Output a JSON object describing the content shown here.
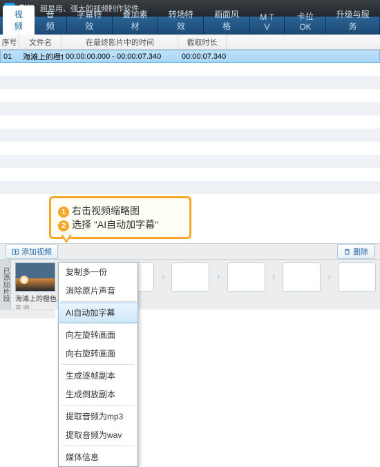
{
  "titlebar": {
    "app_name": "影忆",
    "tagline": "超易用、强大的视频制作软件"
  },
  "tabs": [
    "视 频",
    "音 频",
    "字幕特效",
    "叠加素材",
    "转场特效",
    "画面风格",
    "M T V",
    "卡拉OK",
    "升级与服务"
  ],
  "active_tab": 0,
  "columns": {
    "c1": "序号",
    "c2": "文件名",
    "c3": "在最终影片中的时间",
    "c4": "截取时长"
  },
  "row": {
    "idx": "01",
    "name": "海滩上的橙色..",
    "time": "00:00:00.000 - 00:00:07.340",
    "dur": "00:00:07.340"
  },
  "callout": {
    "l1": "右击视频缩略图",
    "l2": "选择 \"AI自动加字幕\""
  },
  "toolbar": {
    "add": "添加视频",
    "del": "删除"
  },
  "thumb": {
    "name": "海滩上的橙色..",
    "sub": "音 频"
  },
  "tl_label": "已添加片段",
  "ctx": [
    "复制多一份",
    "消除原片声音",
    "AI自动加字幕",
    "向左旋转画面",
    "向右旋转画面",
    "生成逐帧副本",
    "生成倒放副本",
    "提取音频为mp3",
    "提取音频为wav",
    "媒体信息"
  ]
}
